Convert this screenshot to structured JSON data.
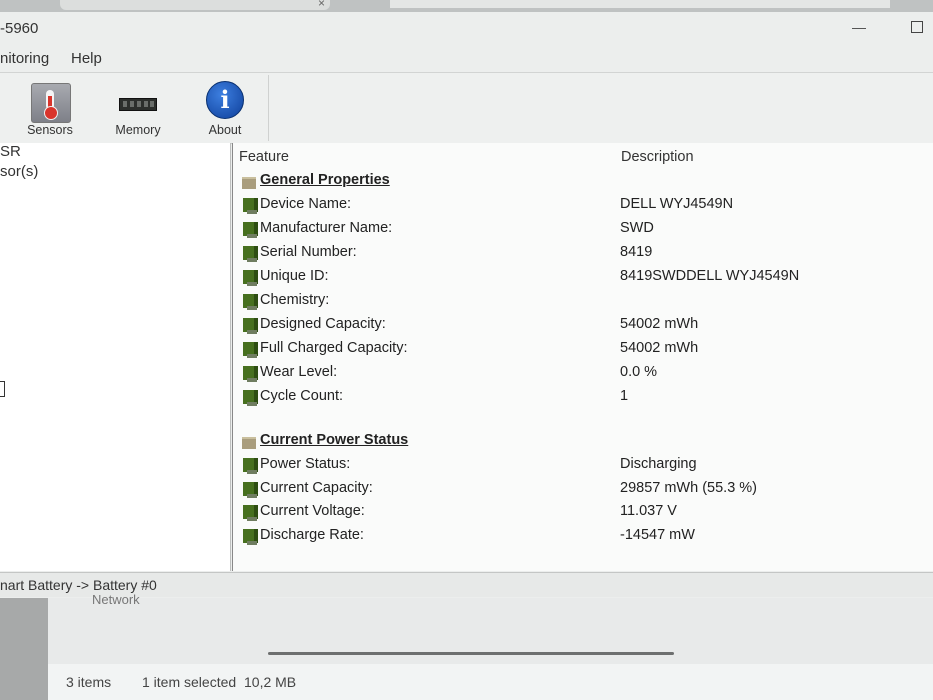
{
  "window": {
    "title": "-5960",
    "menu": [
      "nitoring",
      "Help"
    ]
  },
  "toolbar": {
    "buttons": [
      {
        "label": "Sensors",
        "icon": "thermometer-icon"
      },
      {
        "label": "Memory",
        "icon": "memory-chip-icon"
      },
      {
        "label": "About",
        "icon": "info-icon"
      }
    ]
  },
  "tree": {
    "items": [
      "SR",
      "sor(s)"
    ]
  },
  "list": {
    "columns": [
      "Feature",
      "Description"
    ],
    "sections": [
      {
        "title": "General Properties",
        "rows": [
          {
            "feature": "Device Name:",
            "value": "DELL WYJ4549N"
          },
          {
            "feature": "Manufacturer Name:",
            "value": "SWD"
          },
          {
            "feature": "Serial Number:",
            "value": "8419"
          },
          {
            "feature": "Unique ID:",
            "value": "8419SWDDELL WYJ4549N"
          },
          {
            "feature": "Chemistry:",
            "value": ""
          },
          {
            "feature": "Designed Capacity:",
            "value": "54002 mWh"
          },
          {
            "feature": "Full Charged Capacity:",
            "value": "54002 mWh"
          },
          {
            "feature": "Wear Level:",
            "value": "0.0 %"
          },
          {
            "feature": "Cycle Count:",
            "value": "1"
          }
        ]
      },
      {
        "title": "Current Power Status",
        "rows": [
          {
            "feature": "Power Status:",
            "value": "Discharging"
          },
          {
            "feature": "Current Capacity:",
            "value": "29857 mWh (55.3 %)"
          },
          {
            "feature": "Current Voltage:",
            "value": "11.037 V"
          },
          {
            "feature": "Discharge Rate:",
            "value": "-14547 mW"
          }
        ]
      }
    ]
  },
  "statusbar": {
    "path": "nart Battery -> Battery #0"
  },
  "explorer": {
    "nav_item": "Network",
    "items_count": "3 items",
    "selection": "1 item selected",
    "size": "10,2 MB"
  }
}
